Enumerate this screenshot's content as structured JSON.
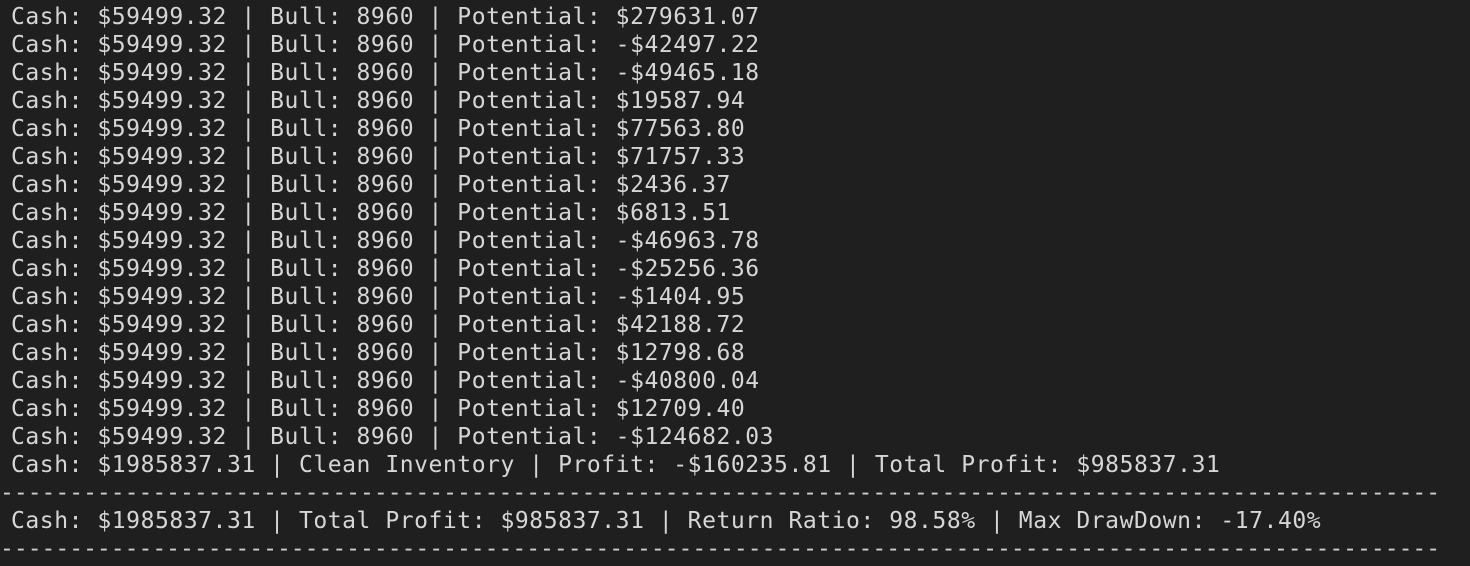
{
  "terminal": {
    "lines": [
      "Cash: $59499.32 | Bull: 8960 | Potential: $279631.07",
      "Cash: $59499.32 | Bull: 8960 | Potential: -$42497.22",
      "Cash: $59499.32 | Bull: 8960 | Potential: -$49465.18",
      "Cash: $59499.32 | Bull: 8960 | Potential: $19587.94",
      "Cash: $59499.32 | Bull: 8960 | Potential: $77563.80",
      "Cash: $59499.32 | Bull: 8960 | Potential: $71757.33",
      "Cash: $59499.32 | Bull: 8960 | Potential: $2436.37",
      "Cash: $59499.32 | Bull: 8960 | Potential: $6813.51",
      "Cash: $59499.32 | Bull: 8960 | Potential: -$46963.78",
      "Cash: $59499.32 | Bull: 8960 | Potential: -$25256.36",
      "Cash: $59499.32 | Bull: 8960 | Potential: -$1404.95",
      "Cash: $59499.32 | Bull: 8960 | Potential: $42188.72",
      "Cash: $59499.32 | Bull: 8960 | Potential: $12798.68",
      "Cash: $59499.32 | Bull: 8960 | Potential: -$40800.04",
      "Cash: $59499.32 | Bull: 8960 | Potential: $12709.40",
      "Cash: $59499.32 | Bull: 8960 | Potential: -$124682.03",
      "Cash: $1985837.31 | Clean Inventory | Profit: -$160235.81 | Total Profit: $985837.31"
    ],
    "separator": "----------------------------------------------------------------------------------------------------------------------------------------------------------------------------------------",
    "summary": "Cash: $1985837.31 | Total Profit: $985837.31 | Return Ratio: 98.58% | Max DrawDown: -17.40%"
  },
  "colors": {
    "background": "#1f1f1f",
    "text": "#d6d6d6"
  }
}
